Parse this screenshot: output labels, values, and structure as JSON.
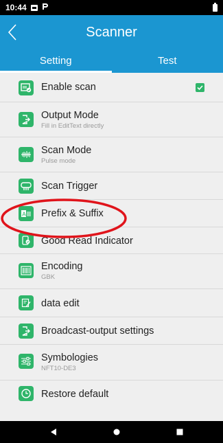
{
  "status_bar": {
    "time": "10:44"
  },
  "app_bar": {
    "title": "Scanner"
  },
  "tabs": [
    {
      "label": "Setting",
      "active": true
    },
    {
      "label": "Test",
      "active": false
    }
  ],
  "settings": [
    {
      "label": "Enable scan",
      "sub": "",
      "icon": "barcode-check-icon",
      "checked": true
    },
    {
      "label": "Output Mode",
      "sub": "Fill in EditText directly",
      "icon": "output-arrow-icon"
    },
    {
      "label": "Scan Mode",
      "sub": "Pulse mode",
      "icon": "pulse-mode-icon"
    },
    {
      "label": "Scan Trigger",
      "sub": "",
      "icon": "trigger-icon"
    },
    {
      "label": "Prefix & Suffix",
      "sub": "",
      "icon": "prefix-suffix-icon"
    },
    {
      "label": "Good Read Indicator",
      "sub": "",
      "icon": "indicator-icon"
    },
    {
      "label": "Encoding",
      "sub": "GBK",
      "icon": "encoding-barcode-icon"
    },
    {
      "label": "data edit",
      "sub": "",
      "icon": "edit-icon"
    },
    {
      "label": "Broadcast-output settings",
      "sub": "",
      "icon": "broadcast-arrow-icon"
    },
    {
      "label": "Symbologies",
      "sub": "NFT10-DE3",
      "icon": "sliders-icon"
    },
    {
      "label": "Restore default",
      "sub": "",
      "icon": "restore-clock-icon"
    }
  ],
  "colors": {
    "accent": "#1b96d1",
    "icon_green": "#2fb56a",
    "annotation_red": "#e0141b"
  }
}
